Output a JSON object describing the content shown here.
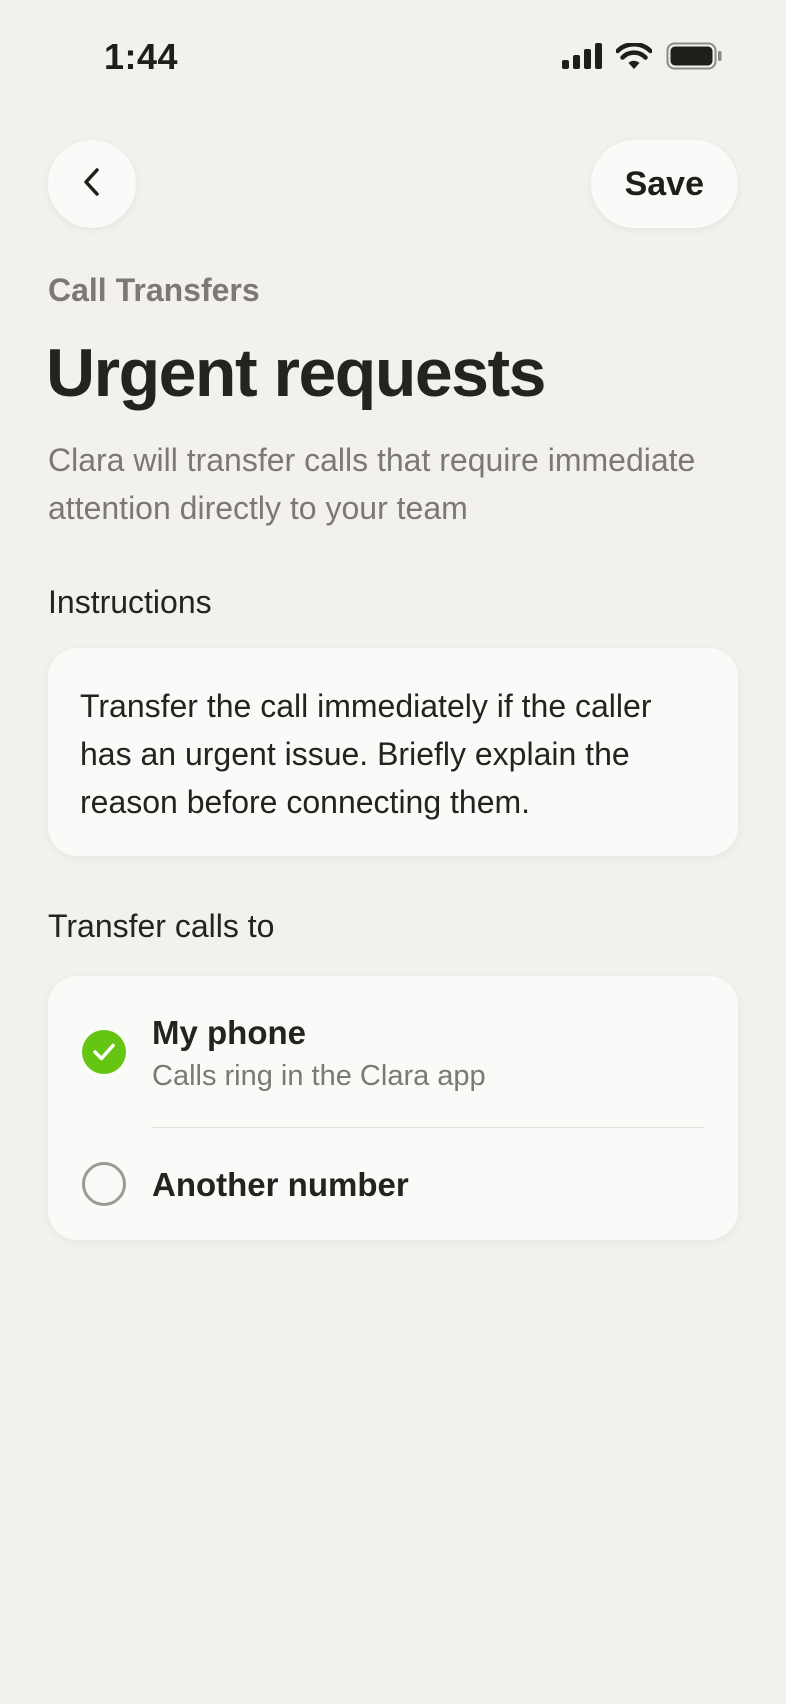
{
  "status_bar": {
    "time": "1:44",
    "icons": [
      "cellular-signal-icon",
      "wifi-icon",
      "battery-icon"
    ]
  },
  "nav": {
    "back_icon": "chevron-left-icon",
    "save_label": "Save"
  },
  "header": {
    "breadcrumb": "Call Transfers",
    "title": "Urgent requests",
    "description": "Clara will transfer calls that require immediate attention directly to your team"
  },
  "instructions": {
    "label": "Instructions",
    "value": "Transfer the call immediately if the caller has an urgent issue. Briefly explain the reason before connecting them."
  },
  "transfer": {
    "label": "Transfer calls to",
    "options": [
      {
        "title": "My phone",
        "subtitle": "Calls ring in the Clara app",
        "selected": true
      },
      {
        "title": "Another number",
        "selected": false
      }
    ]
  },
  "colors": {
    "background": "#f2f1ed",
    "card": "#fafaf9",
    "accent_green": "#66c512",
    "text_primary": "#242320",
    "text_secondary": "#7b7971"
  }
}
